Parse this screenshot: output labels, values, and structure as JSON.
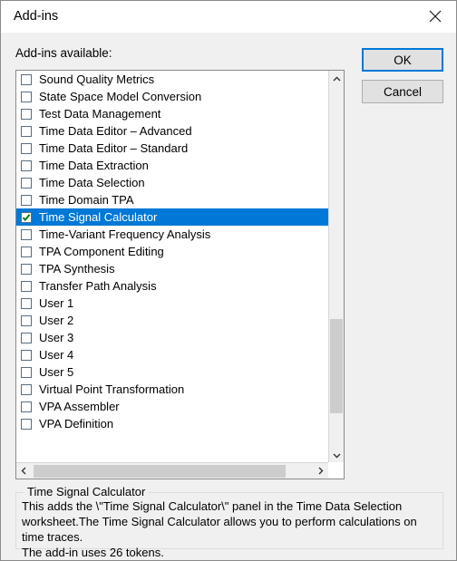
{
  "window": {
    "title": "Add-ins",
    "close_icon": "close-icon"
  },
  "labels": {
    "available": "Add-ins available:"
  },
  "buttons": {
    "ok": "OK",
    "cancel": "Cancel"
  },
  "colors": {
    "selection": "#0078D7",
    "focus_border": "#0078D7",
    "checkmark": "#108010",
    "dialog_bg": "#F0F0F0",
    "list_bg": "#FFFFFF",
    "scrollbar_thumb": "#CDCDCD"
  },
  "list": {
    "items": [
      {
        "label": "Sound Quality Metrics",
        "checked": false,
        "selected": false
      },
      {
        "label": "State Space Model Conversion",
        "checked": false,
        "selected": false
      },
      {
        "label": "Test Data Management",
        "checked": false,
        "selected": false
      },
      {
        "label": "Time Data Editor – Advanced",
        "checked": false,
        "selected": false
      },
      {
        "label": "Time Data Editor – Standard",
        "checked": false,
        "selected": false
      },
      {
        "label": "Time Data Extraction",
        "checked": false,
        "selected": false
      },
      {
        "label": "Time Data Selection",
        "checked": false,
        "selected": false
      },
      {
        "label": "Time Domain TPA",
        "checked": false,
        "selected": false
      },
      {
        "label": "Time Signal Calculator",
        "checked": true,
        "selected": true
      },
      {
        "label": "Time-Variant Frequency Analysis",
        "checked": false,
        "selected": false
      },
      {
        "label": "TPA Component Editing",
        "checked": false,
        "selected": false
      },
      {
        "label": "TPA Synthesis",
        "checked": false,
        "selected": false
      },
      {
        "label": "Transfer Path Analysis",
        "checked": false,
        "selected": false
      },
      {
        "label": "User 1",
        "checked": false,
        "selected": false
      },
      {
        "label": "User 2",
        "checked": false,
        "selected": false
      },
      {
        "label": "User 3",
        "checked": false,
        "selected": false
      },
      {
        "label": "User 4",
        "checked": false,
        "selected": false
      },
      {
        "label": "User 5",
        "checked": false,
        "selected": false
      },
      {
        "label": "Virtual Point Transformation",
        "checked": false,
        "selected": false
      },
      {
        "label": "VPA Assembler",
        "checked": false,
        "selected": false
      },
      {
        "label": "VPA Definition",
        "checked": false,
        "selected": false
      }
    ]
  },
  "scrollbars": {
    "vertical": {
      "up_icon": "chevron-up-icon",
      "down_icon": "chevron-down-icon"
    },
    "horizontal": {
      "left_icon": "chevron-left-icon",
      "right_icon": "chevron-right-icon"
    }
  },
  "description": {
    "title": "Time Signal Calculator",
    "text": "This adds the \\\"Time Signal Calculator\\\" panel in the Time Data Selection worksheet.The Time Signal Calculator allows you to perform calculations on time traces.\nThe add-in uses 26 tokens."
  }
}
